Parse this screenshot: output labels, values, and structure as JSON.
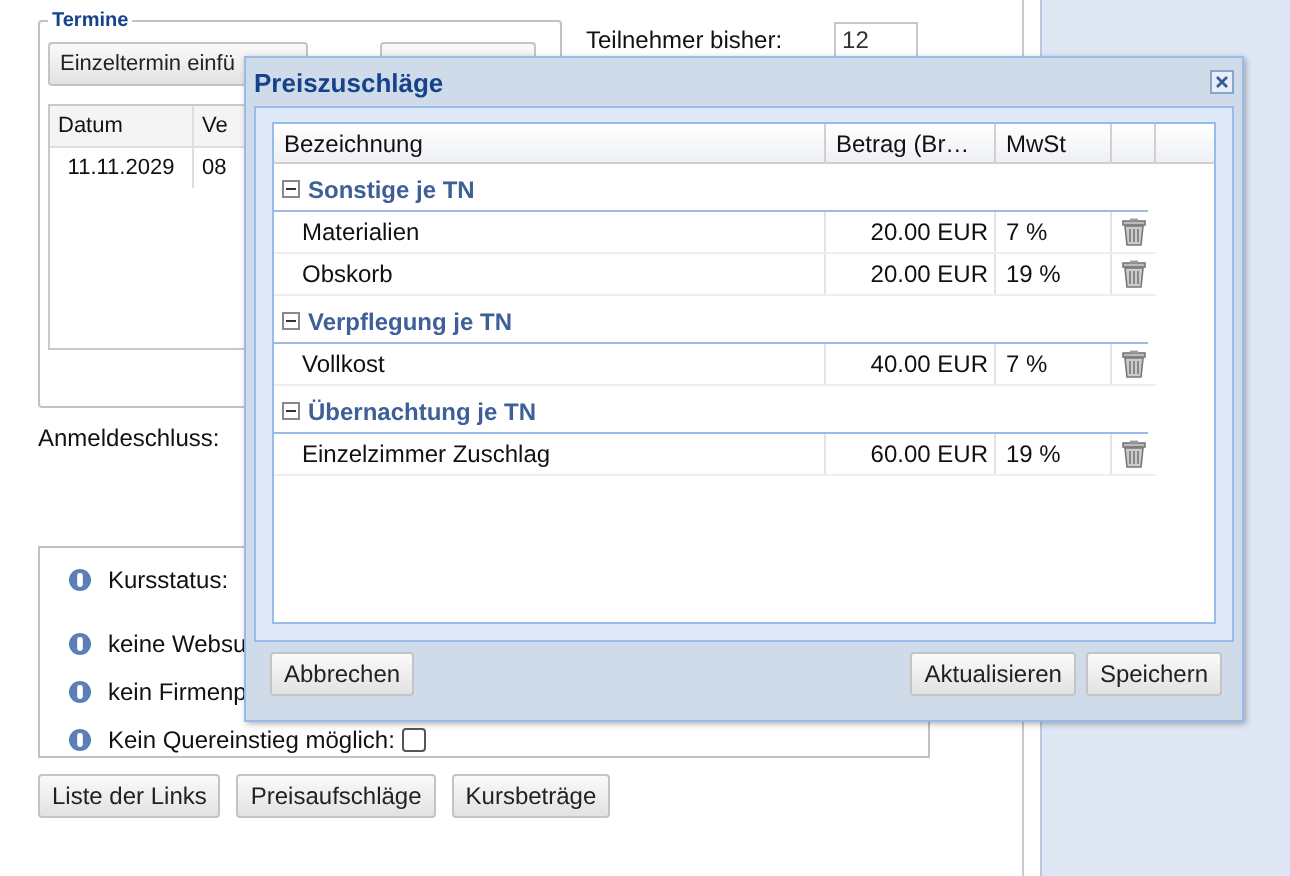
{
  "termine": {
    "legend": "Termine",
    "add_button": "Einzeltermin einfü",
    "columns": [
      "Datum",
      "Ve"
    ],
    "rows": [
      [
        "11.11.2029",
        "08"
      ]
    ]
  },
  "teilnehmer": {
    "label": "Teilnehmer bisher:",
    "value": "12"
  },
  "anmeldeschluss": {
    "label": "Anmeldeschluss:"
  },
  "status_items": [
    {
      "kind": "text",
      "label": "Kursstatus:"
    },
    {
      "kind": "text",
      "label": "keine Websu"
    },
    {
      "kind": "text",
      "label": "kein Firmenp"
    },
    {
      "kind": "checkbox",
      "label": "Kein Quereinstieg möglich:",
      "checked": false
    }
  ],
  "bottom_buttons": [
    "Liste der Links",
    "Preisaufschläge",
    "Kursbeträge"
  ],
  "dialog": {
    "title": "Preiszuschläge",
    "columns": [
      "Bezeichnung",
      "Betrag (Br…",
      "MwSt"
    ],
    "groups": [
      {
        "name": "Sonstige je TN",
        "expanded": true,
        "rows": [
          {
            "name": "Materialien",
            "amount": "20.00 EUR",
            "vat": "7 %"
          },
          {
            "name": "Obskorb",
            "amount": "20.00 EUR",
            "vat": "19 %"
          }
        ]
      },
      {
        "name": "Verpflegung je TN",
        "expanded": true,
        "rows": [
          {
            "name": "Vollkost",
            "amount": "40.00 EUR",
            "vat": "7 %"
          }
        ]
      },
      {
        "name": "Übernachtung je TN",
        "expanded": true,
        "rows": [
          {
            "name": "Einzelzimmer Zuschlag",
            "amount": "60.00 EUR",
            "vat": "19 %"
          }
        ]
      }
    ],
    "cancel_button": "Abbrechen",
    "right_buttons": [
      "Aktualisieren",
      "Speichern"
    ]
  }
}
